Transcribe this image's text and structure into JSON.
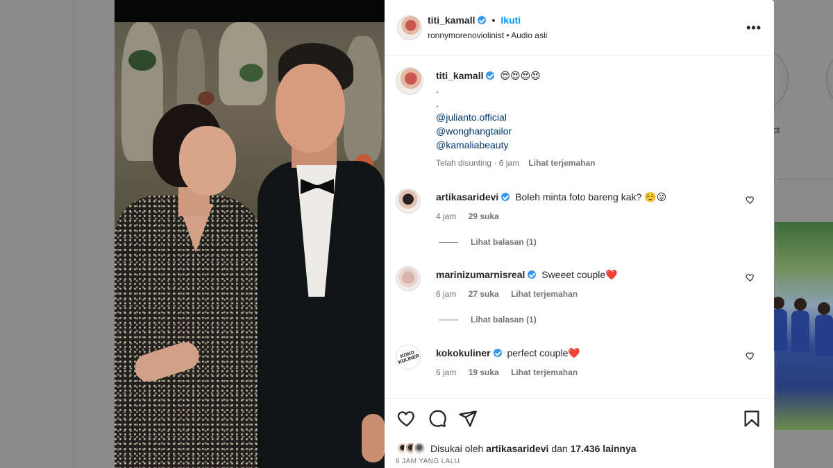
{
  "post": {
    "author": "titi_kamall",
    "follow_label": "Ikuti",
    "separator": "•",
    "subline": "ronnymorenoviolinist • Audio asli",
    "more_icon": "more-horizontal-icon"
  },
  "caption": {
    "author": "titi_kamall",
    "emojis": "😍😍😍😍",
    "dots": [
      ".",
      "."
    ],
    "mentions": [
      "@julianto.official",
      "@wonghangtailor",
      "@kamaliabeauty"
    ],
    "edited": "Telah disunting · 6 jam",
    "translate": "Lihat terjemahan"
  },
  "comments": [
    {
      "author": "artikasaridevi",
      "text": "Boleh minta foto bareng kak? ☺️😜",
      "time": "4 jam",
      "likes": "29 suka",
      "translate": "",
      "replies": "Lihat balasan (1)"
    },
    {
      "author": "marinizumarnisreal",
      "text": "Sweeet couple❤️",
      "time": "6 jam",
      "likes": "27 suka",
      "translate": "Lihat terjemahan",
      "replies": "Lihat balasan (1)"
    },
    {
      "author": "kokokuliner",
      "text": "perfect couple❤️",
      "time": "6 jam",
      "likes": "19 suka",
      "translate": "Lihat terjemahan",
      "replies": ""
    }
  ],
  "koko_logo_text": "KOKO KULINER",
  "actions": {
    "icons": [
      "heart-icon",
      "comment-icon",
      "share-icon",
      "bookmark-icon"
    ]
  },
  "likes": {
    "prefix": "Disukai oleh",
    "user": "artikasaridevi",
    "middle": "dan",
    "count": "17.436 lainnya"
  },
  "timestamp": "6 JAM YANG LALU",
  "background": {
    "side_label": "ict"
  },
  "colors": {
    "link": "#00376b",
    "follow": "#0095f6",
    "verified": "#3897f0",
    "muted": "#737373"
  }
}
